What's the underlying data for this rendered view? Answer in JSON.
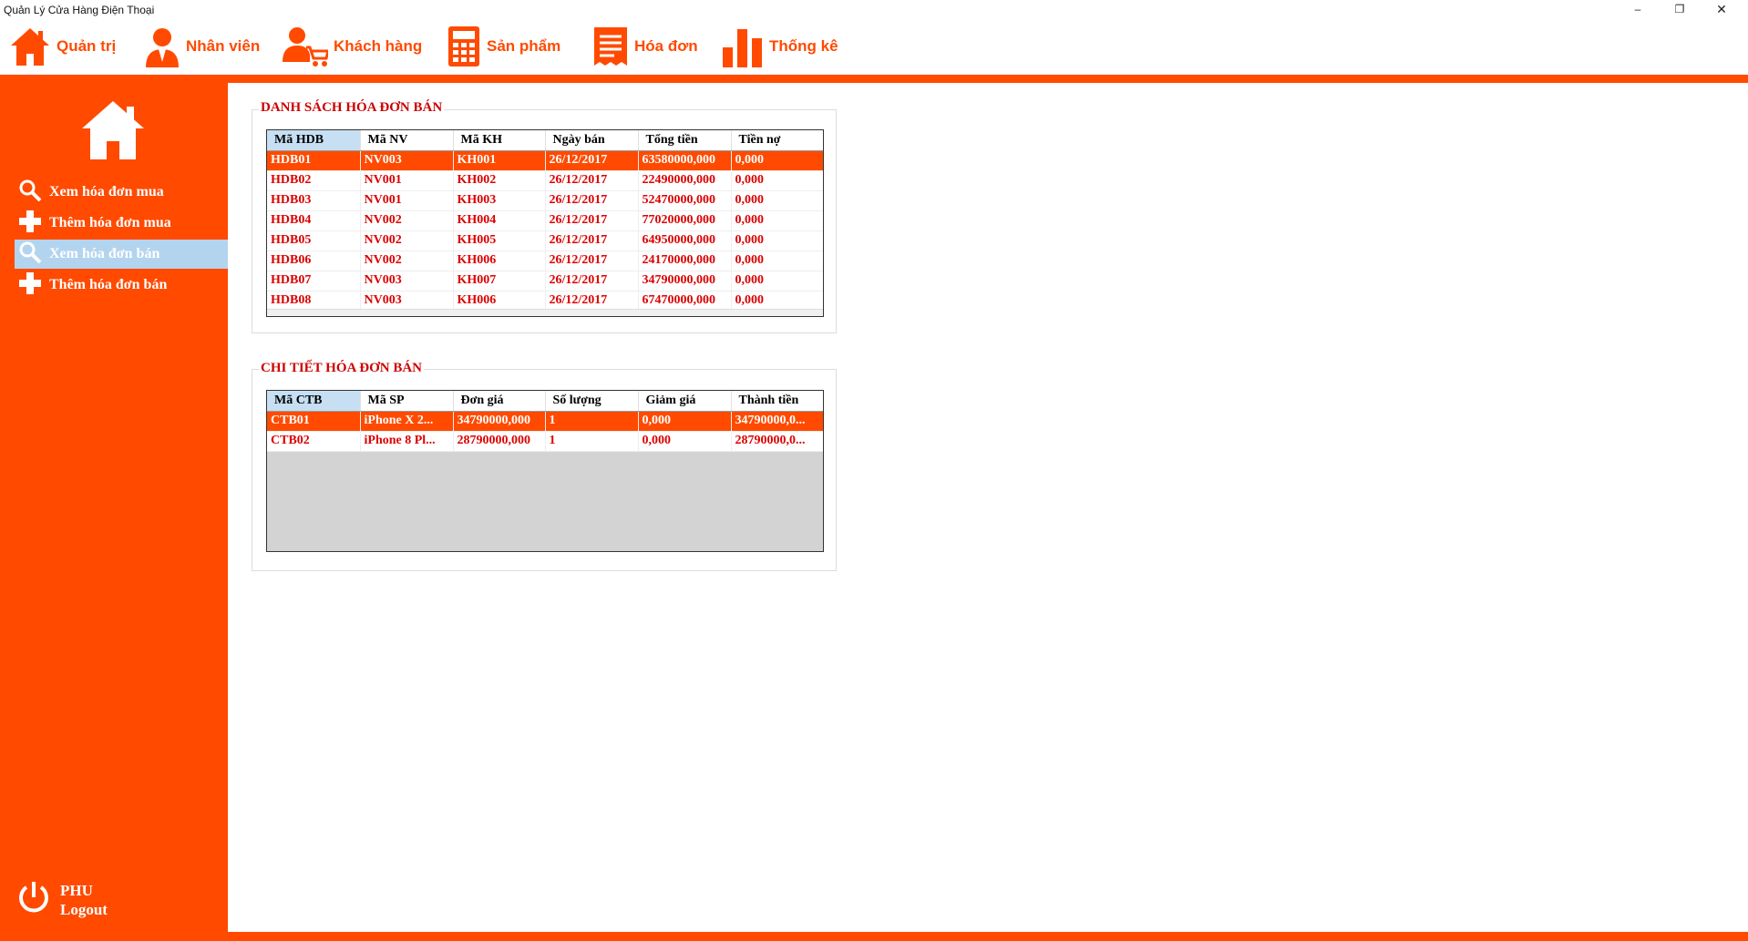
{
  "window": {
    "title": "Quản Lý Cửa Hàng Điện Thoại",
    "minimize": "–",
    "maximize": "❐",
    "close": "✕"
  },
  "menu": [
    {
      "label": "Quản trị",
      "icon": "home-icon"
    },
    {
      "label": "Nhân viên",
      "icon": "employee-icon"
    },
    {
      "label": "Khách hàng",
      "icon": "customer-cart-icon"
    },
    {
      "label": "Sản phẩm",
      "icon": "calculator-icon"
    },
    {
      "label": "Hóa đơn",
      "icon": "invoice-icon"
    },
    {
      "label": "Thống kê",
      "icon": "bar-chart-icon"
    }
  ],
  "sidebar": {
    "items": [
      {
        "label": "Xem hóa đơn mua",
        "icon": "search-icon"
      },
      {
        "label": "Thêm hóa đơn mua",
        "icon": "plus-icon"
      },
      {
        "label": "Xem hóa đơn bán",
        "icon": "search-icon",
        "active": true
      },
      {
        "label": "Thêm hóa đơn bán",
        "icon": "plus-icon"
      }
    ],
    "user": {
      "name": "PHU",
      "logout": "Logout",
      "icon": "power-icon"
    }
  },
  "invoices": {
    "title": "DANH SÁCH HÓA ĐƠN BÁN",
    "columns": [
      "Mã HDB",
      "Mã NV",
      "Mã KH",
      "Ngày bán",
      "Tổng tiền",
      "Tiền nợ"
    ],
    "rows": [
      [
        "HDB01",
        "NV003",
        "KH001",
        "26/12/2017",
        "63580000,000",
        "0,000"
      ],
      [
        "HDB02",
        "NV001",
        "KH002",
        "26/12/2017",
        "22490000,000",
        "0,000"
      ],
      [
        "HDB03",
        "NV001",
        "KH003",
        "26/12/2017",
        "52470000,000",
        "0,000"
      ],
      [
        "HDB04",
        "NV002",
        "KH004",
        "26/12/2017",
        "77020000,000",
        "0,000"
      ],
      [
        "HDB05",
        "NV002",
        "KH005",
        "26/12/2017",
        "64950000,000",
        "0,000"
      ],
      [
        "HDB06",
        "NV002",
        "KH006",
        "26/12/2017",
        "24170000,000",
        "0,000"
      ],
      [
        "HDB07",
        "NV003",
        "KH007",
        "26/12/2017",
        "34790000,000",
        "0,000"
      ],
      [
        "HDB08",
        "NV003",
        "KH006",
        "26/12/2017",
        "67470000,000",
        "0,000"
      ]
    ]
  },
  "details": {
    "title": "CHI TIẾT HÓA ĐƠN BÁN",
    "columns": [
      "Mã CTB",
      "Mã SP",
      "Đơn giá",
      "Số lượng",
      "Giảm giá",
      "Thành tiền"
    ],
    "rows": [
      [
        "CTB01",
        "iPhone X 2...",
        "34790000,000",
        "1",
        "0,000",
        "34790000,0..."
      ],
      [
        "CTB02",
        "iPhone 8 Pl...",
        "28790000,000",
        "1",
        "0,000",
        "28790000,0..."
      ]
    ]
  },
  "colors": {
    "accent": "#ff4a00",
    "text_red": "#dd0000",
    "selection": "#b3d4ee"
  }
}
